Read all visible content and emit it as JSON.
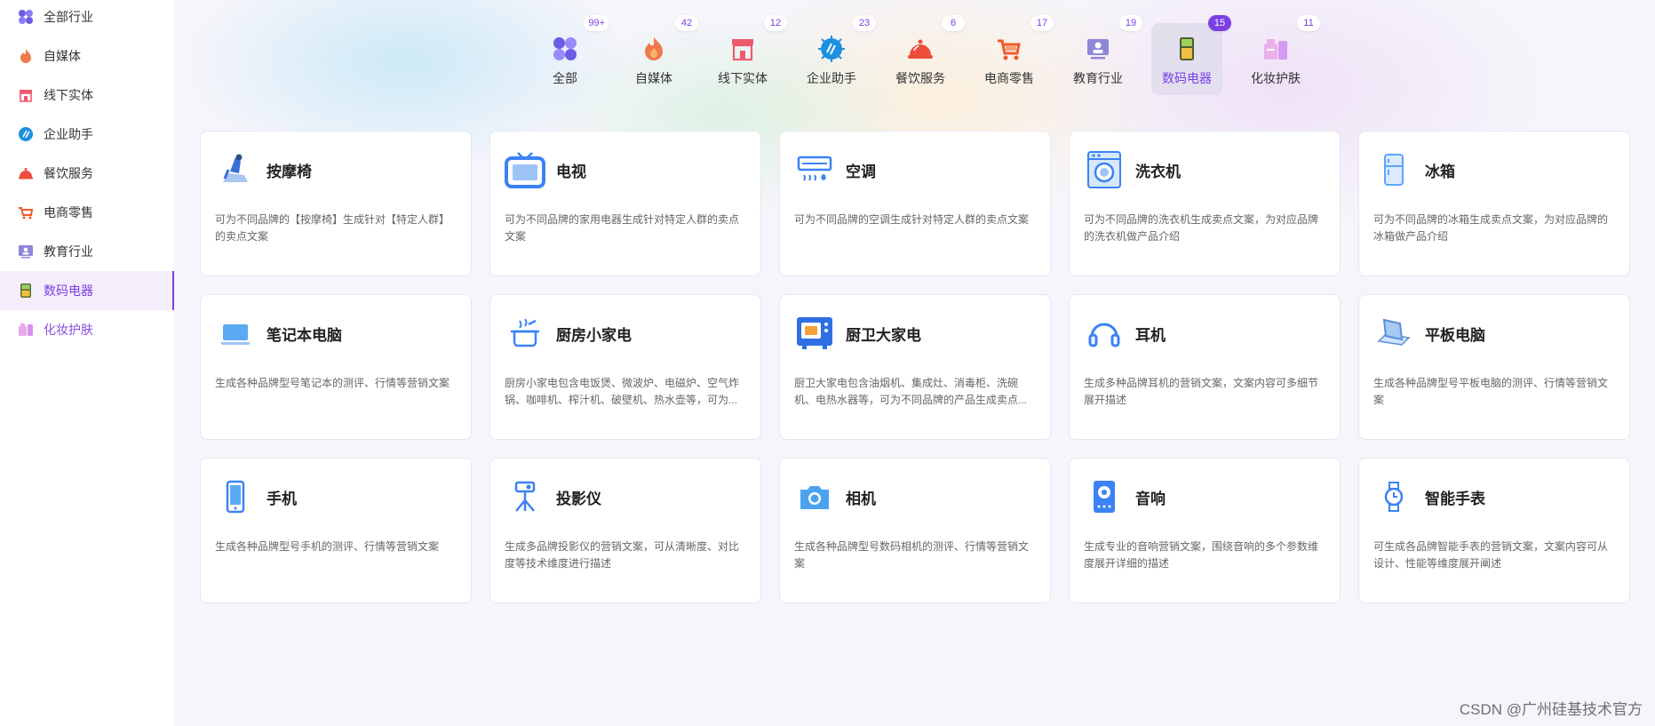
{
  "sidebar": {
    "items": [
      {
        "label": "全部行业",
        "icon": "all-icon"
      },
      {
        "label": "自媒体",
        "icon": "flame-icon"
      },
      {
        "label": "线下实体",
        "icon": "shop-icon"
      },
      {
        "label": "企业助手",
        "icon": "chip-icon"
      },
      {
        "label": "餐饮服务",
        "icon": "cloche-icon"
      },
      {
        "label": "电商零售",
        "icon": "cart-icon"
      },
      {
        "label": "教育行业",
        "icon": "education-icon"
      },
      {
        "label": "数码电器",
        "icon": "fridge-icon"
      },
      {
        "label": "化妆护肤",
        "icon": "cosmetics-icon"
      }
    ],
    "active_index": 7
  },
  "categories": [
    {
      "label": "全部",
      "count": "99+",
      "icon": "all-icon"
    },
    {
      "label": "自媒体",
      "count": "42",
      "icon": "flame-icon"
    },
    {
      "label": "线下实体",
      "count": "12",
      "icon": "shop-icon"
    },
    {
      "label": "企业助手",
      "count": "23",
      "icon": "chip-icon"
    },
    {
      "label": "餐饮服务",
      "count": "6",
      "icon": "cloche-icon"
    },
    {
      "label": "电商零售",
      "count": "17",
      "icon": "cart-icon"
    },
    {
      "label": "教育行业",
      "count": "19",
      "icon": "education-icon"
    },
    {
      "label": "数码电器",
      "count": "15",
      "icon": "fridge-icon"
    },
    {
      "label": "化妆护肤",
      "count": "11",
      "icon": "cosmetics-icon"
    }
  ],
  "cards": [
    {
      "title": "按摩椅",
      "icon": "massage-chair-icon",
      "desc": "可为不同品牌的【按摩椅】生成针对【特定人群】的卖点文案"
    },
    {
      "title": "电视",
      "icon": "tv-icon",
      "desc": "可为不同品牌的家用电器生成针对特定人群的卖点文案"
    },
    {
      "title": "空调",
      "icon": "air-conditioner-icon",
      "desc": "可为不同品牌的空调生成针对特定人群的卖点文案"
    },
    {
      "title": "洗衣机",
      "icon": "washing-machine-icon",
      "desc": "可为不同品牌的洗衣机生成卖点文案，为对应品牌的洗衣机做产品介绍"
    },
    {
      "title": "冰箱",
      "icon": "fridge-icon",
      "desc": "可为不同品牌的冰箱生成卖点文案，为对应品牌的冰箱做产品介绍"
    },
    {
      "title": "笔记本电脑",
      "icon": "laptop-icon",
      "desc": "生成各种品牌型号笔记本的测评、行情等营销文案"
    },
    {
      "title": "厨房小家电",
      "icon": "kitchen-pot-icon",
      "desc": "厨房小家电包含电饭煲、微波炉、电磁炉、空气炸锅、咖啡机、榨汁机、破壁机、热水壶等，可为..."
    },
    {
      "title": "厨卫大家电",
      "icon": "oven-icon",
      "desc": "厨卫大家电包含油烟机、集成灶、消毒柜、洗碗机、电热水器等，可为不同品牌的产品生成卖点..."
    },
    {
      "title": "耳机",
      "icon": "headphones-icon",
      "desc": "生成多种品牌耳机的营销文案，文案内容可多细节展开描述"
    },
    {
      "title": "平板电脑",
      "icon": "tablet-icon",
      "desc": "生成各种品牌型号平板电脑的测评、行情等营销文案"
    },
    {
      "title": "手机",
      "icon": "phone-icon",
      "desc": "生成各种品牌型号手机的测评、行情等营销文案"
    },
    {
      "title": "投影仪",
      "icon": "projector-icon",
      "desc": "生成多品牌投影仪的营销文案，可从清晰度、对比度等技术维度进行描述"
    },
    {
      "title": "相机",
      "icon": "camera-icon",
      "desc": "生成各种品牌型号数码相机的测评、行情等营销文案"
    },
    {
      "title": "音响",
      "icon": "speaker-icon",
      "desc": "生成专业的音响营销文案，围绕音响的多个参数维度展开详细的描述"
    },
    {
      "title": "智能手表",
      "icon": "smartwatch-icon",
      "desc": "可生成各品牌智能手表的营销文案，文案内容可从设计、性能等维度展开阐述"
    }
  ],
  "watermark": "CSDN @广州硅基技术官方",
  "colors": {
    "accent": "#7b3fe4",
    "card_icon_blue": "#3b82f6"
  }
}
